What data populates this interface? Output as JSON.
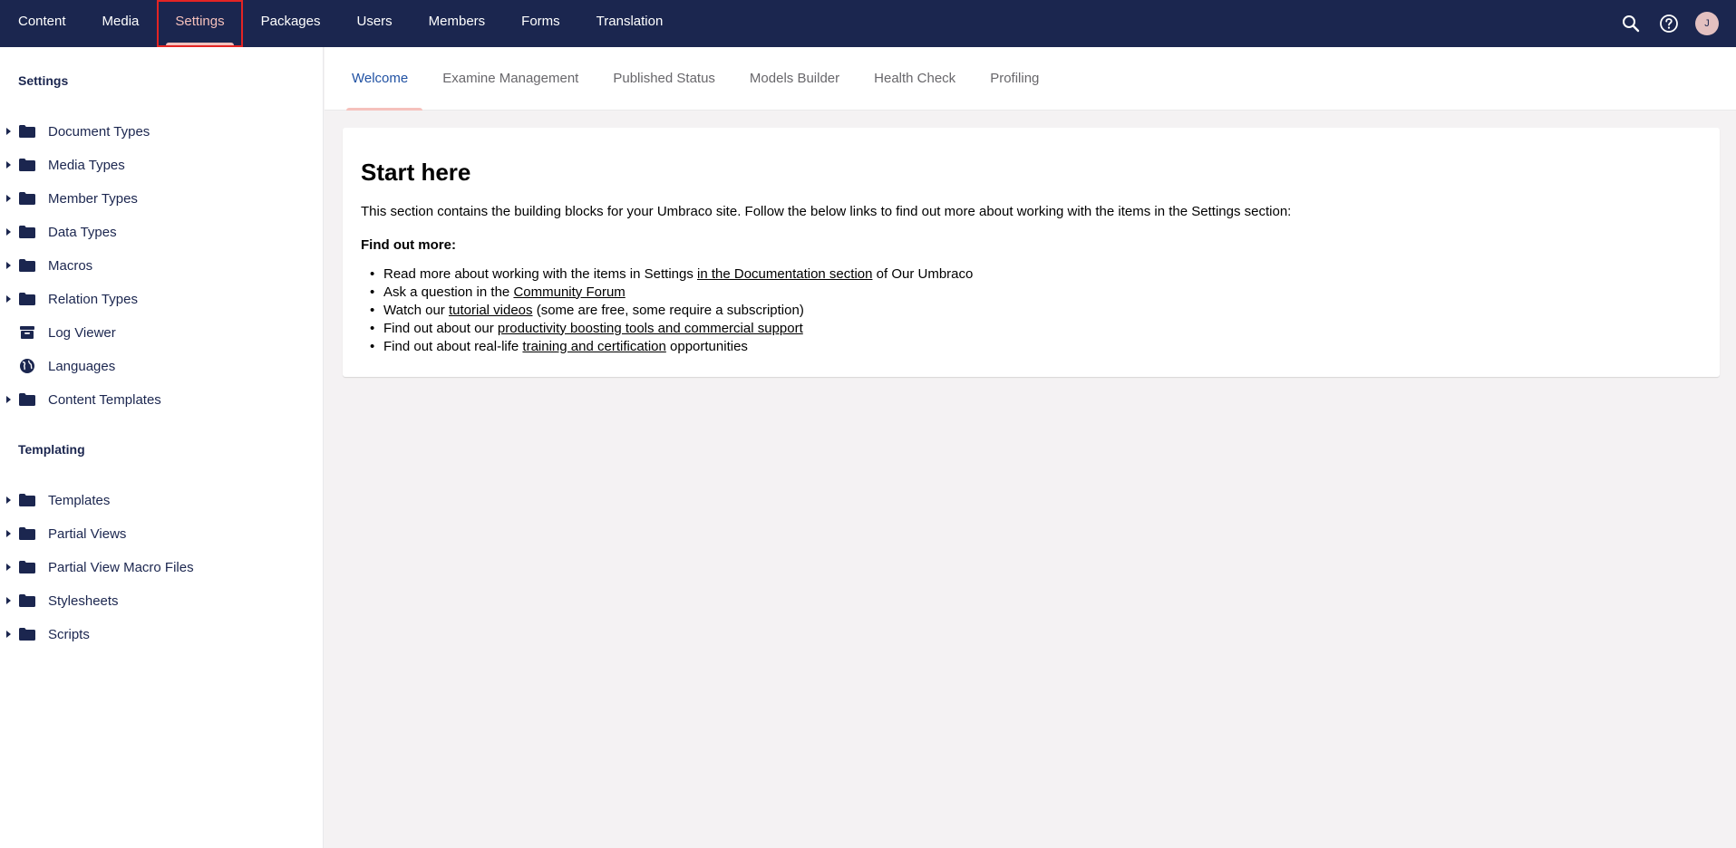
{
  "topbar": {
    "sections": [
      {
        "label": "Content"
      },
      {
        "label": "Media"
      },
      {
        "label": "Settings"
      },
      {
        "label": "Packages"
      },
      {
        "label": "Users"
      },
      {
        "label": "Members"
      },
      {
        "label": "Forms"
      },
      {
        "label": "Translation"
      }
    ],
    "active_section": "Settings",
    "icons": [
      "search-icon",
      "help-icon"
    ],
    "avatar_initial": "J"
  },
  "sidebar": {
    "settings_title": "Settings",
    "settings_items": [
      {
        "label": "Document Types",
        "icon": "folder-icon",
        "expandable": true
      },
      {
        "label": "Media Types",
        "icon": "folder-icon",
        "expandable": true
      },
      {
        "label": "Member Types",
        "icon": "folder-icon",
        "expandable": true
      },
      {
        "label": "Data Types",
        "icon": "folder-icon",
        "expandable": true
      },
      {
        "label": "Macros",
        "icon": "folder-icon",
        "expandable": true
      },
      {
        "label": "Relation Types",
        "icon": "folder-icon",
        "expandable": true
      },
      {
        "label": "Log Viewer",
        "icon": "archive-icon",
        "expandable": false
      },
      {
        "label": "Languages",
        "icon": "globe-icon",
        "expandable": false
      },
      {
        "label": "Content Templates",
        "icon": "folder-icon",
        "expandable": true
      }
    ],
    "templating_title": "Templating",
    "templating_items": [
      {
        "label": "Templates",
        "icon": "folder-icon",
        "expandable": true
      },
      {
        "label": "Partial Views",
        "icon": "folder-icon",
        "expandable": true
      },
      {
        "label": "Partial View Macro Files",
        "icon": "folder-icon",
        "expandable": true
      },
      {
        "label": "Stylesheets",
        "icon": "folder-icon",
        "expandable": true
      },
      {
        "label": "Scripts",
        "icon": "folder-icon",
        "expandable": true
      }
    ]
  },
  "tabs": [
    {
      "label": "Welcome"
    },
    {
      "label": "Examine Management"
    },
    {
      "label": "Published Status"
    },
    {
      "label": "Models Builder"
    },
    {
      "label": "Health Check"
    },
    {
      "label": "Profiling"
    }
  ],
  "active_tab": "Welcome",
  "main": {
    "heading": "Start here",
    "intro": "This section contains the building blocks for your Umbraco site. Follow the below links to find out more about working with the items in the Settings section:",
    "find_more": "Find out more:",
    "bullets": [
      {
        "before": "Read more about working with the items in Settings ",
        "link": "in the Documentation section",
        "after": " of Our Umbraco"
      },
      {
        "before": "Ask a question in the ",
        "link": "Community Forum",
        "after": ""
      },
      {
        "before": "Watch our ",
        "link": "tutorial videos",
        "after": " (some are free, some require a subscription)"
      },
      {
        "before": "Find out about our ",
        "link": "productivity boosting tools and commercial support",
        "after": ""
      },
      {
        "before": "Find out about real-life ",
        "link": "training and certification",
        "after": " opportunities"
      }
    ]
  },
  "colors": {
    "topbar_bg": "#1b264f",
    "active_accent": "#f5c1bc",
    "highlight_box": "#e32424",
    "active_tab_text": "#2152a3"
  }
}
